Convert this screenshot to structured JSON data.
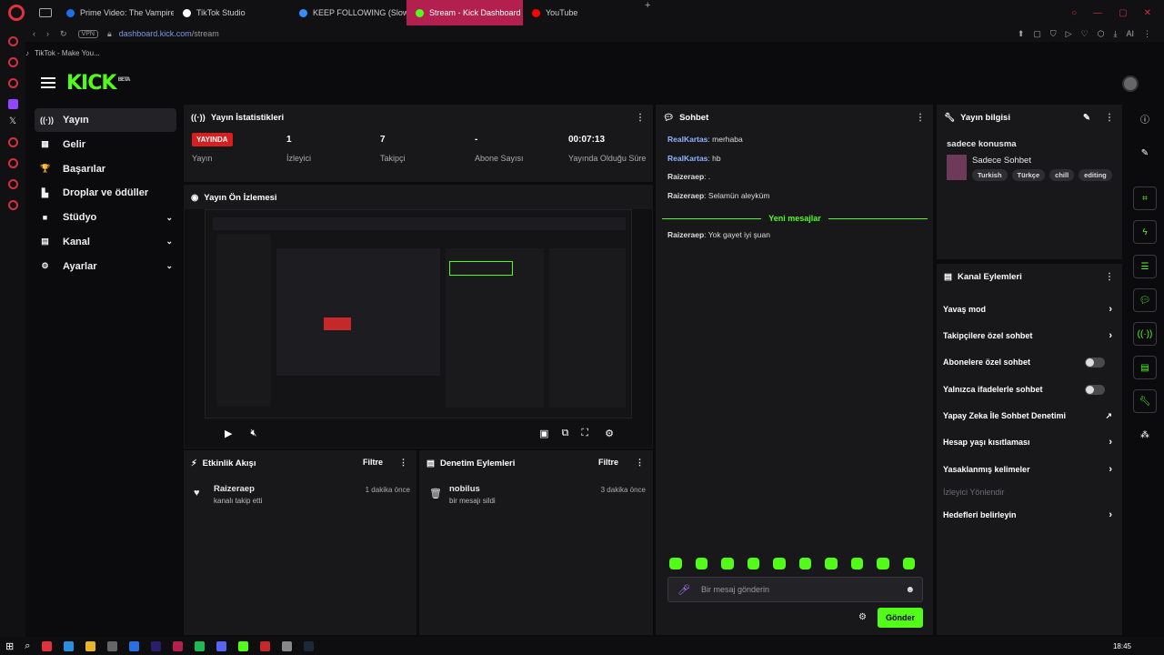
{
  "browser": {
    "tabs": [
      {
        "label": "Prime Video: The Vampire",
        "color": "#1f6feb"
      },
      {
        "label": "TikTok Studio",
        "color": "#ffffff"
      },
      {
        "label": "KEEP FOLLOWING (Slowe",
        "color": "#3b8cff"
      },
      {
        "label": "Stream - Kick Dashboard",
        "color": "#53fc18"
      },
      {
        "label": "YouTube",
        "color": "#ff0000"
      }
    ],
    "active_tab": 3,
    "url_host": "dashboard.kick.com",
    "url_path": "/stream",
    "vpn": "VPN",
    "bookmark": "TikTok - Make You...",
    "ai_label": "AI"
  },
  "kick": {
    "logo": "KICK",
    "logo_sup": "BETA",
    "nav": [
      {
        "label": "Yayın",
        "icon": "broadcast-icon",
        "glyph": "((·))",
        "active": true
      },
      {
        "label": "Gelir",
        "icon": "chart-icon",
        "glyph": "▦"
      },
      {
        "label": "Başarılar",
        "icon": "trophy-icon",
        "glyph": "🏆"
      },
      {
        "label": "Droplar ve ödüller",
        "icon": "gift-icon",
        "glyph": "▙"
      },
      {
        "label": "Stüdyo",
        "icon": "video-icon",
        "glyph": "■",
        "chev": true
      },
      {
        "label": "Kanal",
        "icon": "layers-icon",
        "glyph": "▤",
        "chev": true
      },
      {
        "label": "Ayarlar",
        "icon": "gear-icon",
        "glyph": "⚙",
        "chev": true
      }
    ],
    "stats": {
      "title": "Yayın İstatistikleri",
      "live_badge": "YAYINDA",
      "items": [
        {
          "value": "",
          "label": "Yayın"
        },
        {
          "value": "1",
          "label": "İzleyici"
        },
        {
          "value": "7",
          "label": "Takipçi"
        },
        {
          "value": "-",
          "label": "Abone Sayısı"
        },
        {
          "value": "00:07:13",
          "label": "Yayında Olduğu Süre"
        }
      ]
    },
    "preview": {
      "title": "Yayın Ön İzlemesi"
    },
    "activity": {
      "title": "Etkinlik Akışı",
      "filter": "Filtre",
      "items": [
        {
          "user": "Raizeraep",
          "text": "kanalı takip etti",
          "time": "1 dakika önce"
        }
      ]
    },
    "moderation": {
      "title": "Denetim Eylemleri",
      "filter": "Filtre",
      "items": [
        {
          "user": "nobilus",
          "text": "bir mesajı sildi",
          "time": "3 dakika önce"
        }
      ]
    },
    "chat": {
      "title": "Sohbet",
      "messages": [
        {
          "user": "RealKartas",
          "text": "merhaba",
          "color": "#8fb4ff"
        },
        {
          "user": "RealKartas",
          "text": "hb",
          "color": "#8fb4ff"
        },
        {
          "user": "Raizeraep",
          "text": ".",
          "color": "#dddddd"
        },
        {
          "user": "Raizeraep",
          "text": "Selamün aleyküm",
          "color": "#dddddd"
        }
      ],
      "new_label": "Yeni mesajlar",
      "new_messages": [
        {
          "user": "Raizeraep",
          "text": "Yok gayet iyi şuan",
          "color": "#dddddd"
        }
      ],
      "placeholder": "Bir mesaj gönderin",
      "send": "Gönder"
    },
    "stream_info": {
      "title": "Yayın bilgisi",
      "stream_title": "sadece konusma",
      "category": "Sadece Sohbet",
      "tags": [
        "Turkish",
        "Türkçe",
        "chill",
        "editing"
      ]
    },
    "channel_actions": {
      "title": "Kanal Eylemleri",
      "items": [
        {
          "label": "Yavaş mod",
          "kind": "chevron"
        },
        {
          "label": "Takipçilere özel sohbet",
          "kind": "chevron"
        },
        {
          "label": "Abonelere özel sohbet",
          "kind": "toggle"
        },
        {
          "label": "Yalnızca ifadelerle sohbet",
          "kind": "toggle"
        },
        {
          "label": "Yapay Zeka İle Sohbet Denetimi",
          "kind": "external"
        },
        {
          "label": "Hesap yaşı kısıtlaması",
          "kind": "chevron"
        },
        {
          "label": "Yasaklanmış kelimeler",
          "kind": "chevron"
        },
        {
          "label": "İzleyici Yönlendir",
          "kind": "disabled"
        },
        {
          "label": "Hedefleri belirleyin",
          "kind": "chevron"
        }
      ]
    }
  },
  "taskbar": {
    "time": "18:45"
  },
  "colors": {
    "accent": "#53fc18",
    "live": "#d61f1f",
    "panel": "#18181b"
  }
}
